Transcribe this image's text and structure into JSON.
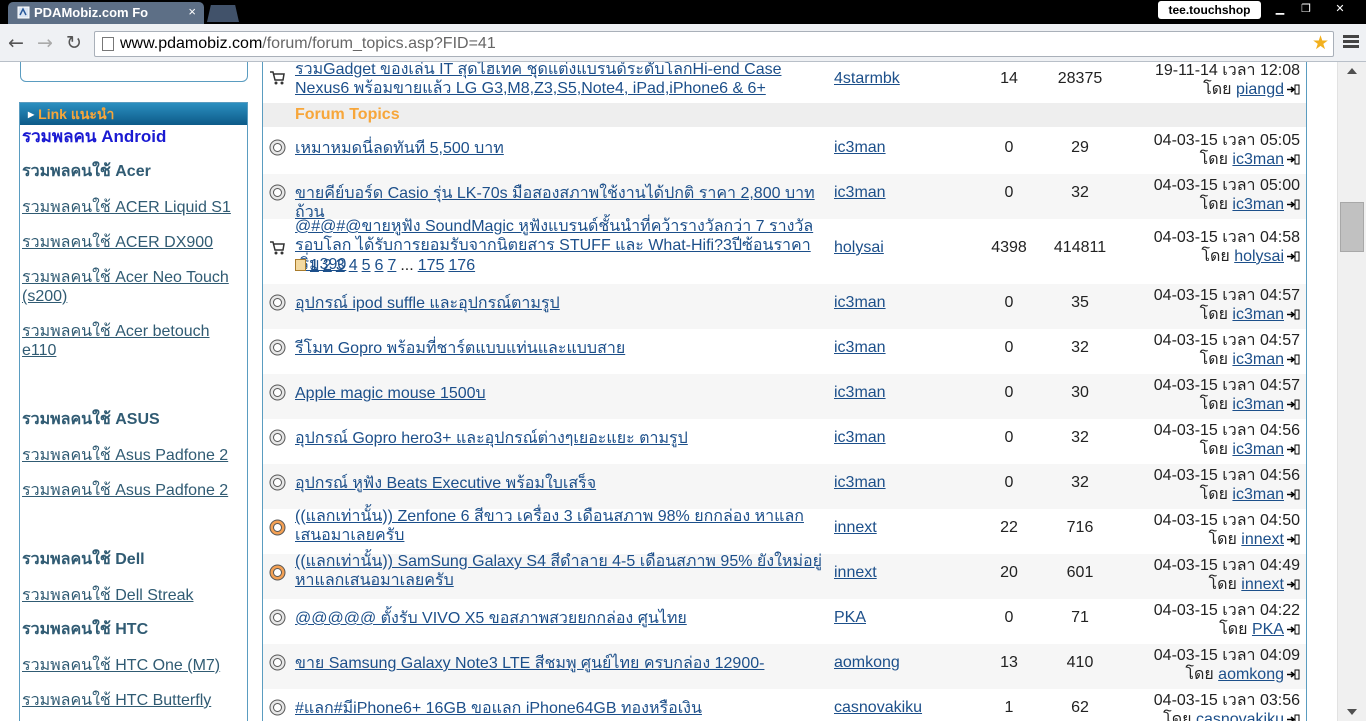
{
  "tab": {
    "title": "PDAMobiz.com Fo",
    "close": "×"
  },
  "profile": {
    "name": "tee.touchshop"
  },
  "window": {
    "minimize": "▁",
    "restore": "❐",
    "close": "✕"
  },
  "toolbar": {
    "back": "←",
    "forward": "→",
    "reload": "↻",
    "url_domain": "www.pdamobiz.com",
    "url_path": "/forum/forum_topics.asp?FID=41",
    "star": "★"
  },
  "sidebar": {
    "header": "Link แนะนำ",
    "links": [
      "รวมพลคน Android",
      "รวมพลคนใช้ Acer",
      "รวมพลคนใช้ ACER Liquid S1",
      "รวมพลคนใช้ ACER DX900",
      "รวมพลคนใช้ Acer Neo Touch (s200)",
      "รวมพลคนใช้ Acer betouch e110",
      "รวมพลคนใช้ ASUS",
      "รวมพลคนใช้ Asus Padfone 2",
      "รวมพลคนใช้ Asus Padfone 2",
      "รวมพลคนใช้ Dell",
      "รวมพลคนใช้ Dell Streak",
      "รวมพลคนใช้ HTC",
      "รวมพลคนใช้ HTC One (M7)",
      "รวมพลคนใช้ HTC Butterfly"
    ]
  },
  "forum": {
    "pinned": {
      "title": "รวมGadget ของเล่น IT สุดไฮเทค ชุดแต่งแบรนด์ระดับโลกHi-end Case Nexus6 พร้อมขายแล้ว LG G3,M8,Z3,S5,Note4, iPad,iPhone6 & 6+",
      "author": "4starmbk",
      "replies": "14",
      "views": "28375",
      "date": "19-11-14 เวลา 12:08",
      "by_label": "โดย",
      "last_by": "piangd"
    },
    "section_title": "Forum Topics",
    "topics": [
      {
        "title": "เหมาหมดนี่ลดทันที 5,500 บาท",
        "author": "ic3man",
        "replies": "0",
        "views": "29",
        "date": "04-03-15 เวลา 05:05",
        "last_by": "ic3man"
      },
      {
        "title": "ขายคีย์บอร์ด Casio รุ่น LK-70s มือสองสภาพใช้งานได้ปกติ ราคา 2,800 บาทถ้วน",
        "author": "ic3man",
        "replies": "0",
        "views": "32",
        "date": "04-03-15 เวลา 05:00",
        "last_by": "ic3man"
      },
      {
        "title": "@#@#@ขายหูฟัง SoundMagic หูฟังแบรนด์ชั้นนำที่คว้ารางวัลกว่า 7 รางวัลรอบโลก ได้รับการยอมรับจากนิตยสาร STUFF และ What-Hifi?3ปีซ้อนราคาเริ่ม390",
        "author": "holysai",
        "replies": "4398",
        "views": "414811",
        "date": "04-03-15 เวลา 04:58",
        "last_by": "holysai",
        "pages": [
          "1",
          "2",
          "3",
          "4",
          "5",
          "6",
          "7",
          "...",
          "175",
          "176"
        ]
      },
      {
        "title": "อุปกรณ์ ipod suffle และอุปกรณ์ตามรูป",
        "author": "ic3man",
        "replies": "0",
        "views": "35",
        "date": "04-03-15 เวลา 04:57",
        "last_by": "ic3man"
      },
      {
        "title": "รีโมท Gopro พร้อมที่ชาร์ตแบบแท่นและแบบสาย",
        "author": "ic3man",
        "replies": "0",
        "views": "32",
        "date": "04-03-15 เวลา 04:57",
        "last_by": "ic3man"
      },
      {
        "title": "Apple magic mouse 1500บ",
        "author": "ic3man",
        "replies": "0",
        "views": "30",
        "date": "04-03-15 เวลา 04:57",
        "last_by": "ic3man"
      },
      {
        "title": "อุปกรณ์ Gopro hero3+ และอุปกรณ์ต่างๆเยอะแยะ ตามรูป",
        "author": "ic3man",
        "replies": "0",
        "views": "32",
        "date": "04-03-15 เวลา 04:56",
        "last_by": "ic3man"
      },
      {
        "title": "อุปกรณ์ หูฟัง Beats Executive พร้อมใบเสร็จ",
        "author": "ic3man",
        "replies": "0",
        "views": "32",
        "date": "04-03-15 เวลา 04:56",
        "last_by": "ic3man"
      },
      {
        "title": "((แลกเท่านั้น)) Zenfone 6 สีขาว เครื่อง 3 เดือนสภาพ 98% ยกกล่อง หาแลกเสนอมาเลยครับ",
        "author": "innext",
        "replies": "22",
        "views": "716",
        "date": "04-03-15 เวลา 04:50",
        "last_by": "innext"
      },
      {
        "title": "((แลกเท่านั้น)) SamSung Galaxy S4 สีดำลาย 4-5 เดือนสภาพ 95% ยังใหม่อยู่ หาแลกเสนอมาเลยครับ",
        "author": "innext",
        "replies": "20",
        "views": "601",
        "date": "04-03-15 เวลา 04:49",
        "last_by": "innext"
      },
      {
        "title": "@@@@@ ตั้งรับ VIVO X5 ขอสภาพสวยยกกล่อง ศูนไทย",
        "author": "PKA",
        "replies": "0",
        "views": "71",
        "date": "04-03-15 เวลา 04:22",
        "last_by": "PKA"
      },
      {
        "title": "ขาย Samsung Galaxy Note3 LTE สีชมพู ศูนย์ไทย ครบกล่อง 12900-",
        "author": "aomkong",
        "replies": "13",
        "views": "410",
        "date": "04-03-15 เวลา 04:09",
        "last_by": "aomkong"
      },
      {
        "title": "#แลก#มีiPhone6+ 16GB ขอแลก iPhone64GB ทองหรือเงิน",
        "author": "casnovakiku",
        "replies": "1",
        "views": "62",
        "date": "04-03-15 เวลา 03:56",
        "last_by": "casnovakiku"
      }
    ]
  },
  "colors": {
    "link": "#1c4f8a",
    "section": "#f7a63a",
    "border": "#5a9cc0"
  }
}
